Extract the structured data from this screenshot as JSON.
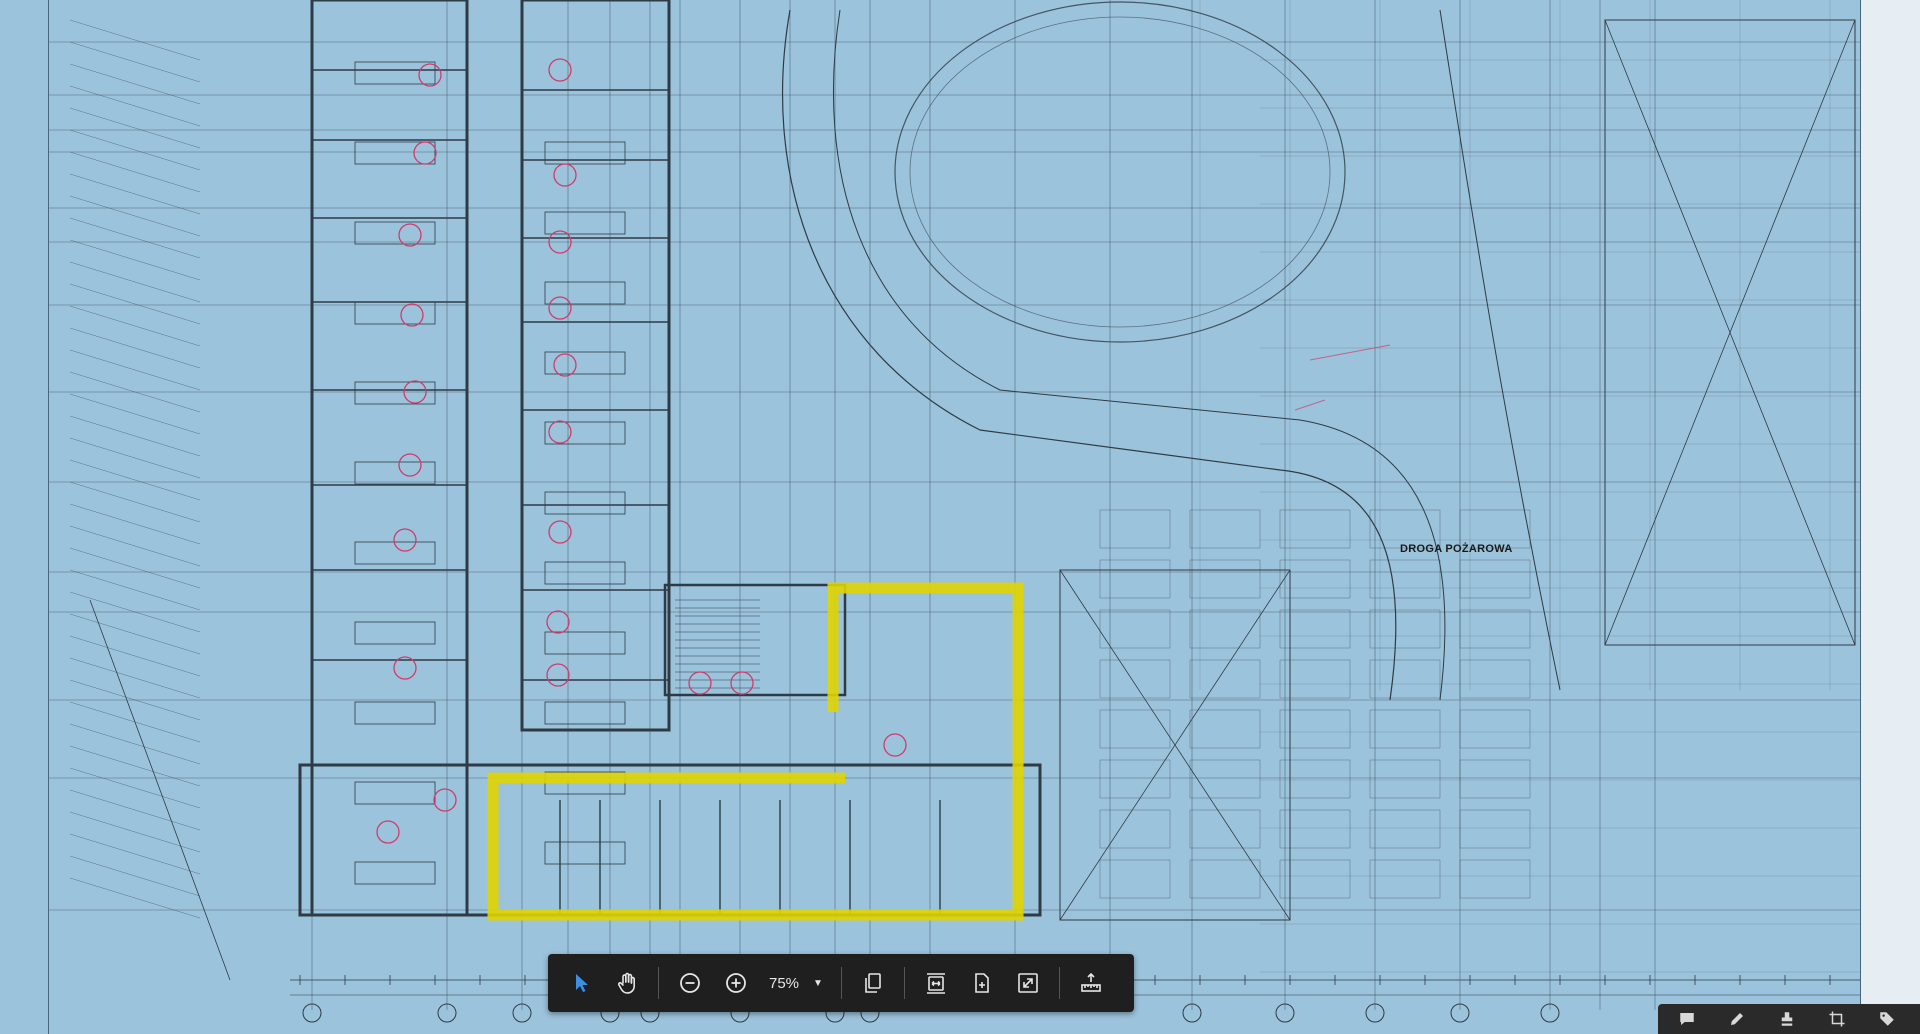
{
  "drawing": {
    "road_label": "DROGA POŻAROWA"
  },
  "toolbar": {
    "zoom_level": "75%",
    "tools": [
      {
        "name": "select-tool",
        "icon": "cursor-arrow-icon",
        "active": true
      },
      {
        "name": "pan-tool",
        "icon": "hand-icon"
      },
      {
        "name": "zoom-out",
        "icon": "zoom-out-icon"
      },
      {
        "name": "zoom-in",
        "icon": "zoom-in-icon"
      },
      {
        "name": "page-view",
        "icon": "pages-icon"
      },
      {
        "name": "fit-width",
        "icon": "fit-width-icon"
      },
      {
        "name": "fit-page",
        "icon": "fit-page-icon"
      },
      {
        "name": "fullscreen",
        "icon": "expand-icon"
      },
      {
        "name": "measure",
        "icon": "ruler-icon"
      }
    ]
  },
  "colors": {
    "paper": "#9cc3dc",
    "ink": "#2e3b45",
    "highlight": "#e0d400",
    "toolbar_bg": "#1f1f1f",
    "active_tool": "#3d8fe0",
    "markup": "#d23a6a"
  }
}
